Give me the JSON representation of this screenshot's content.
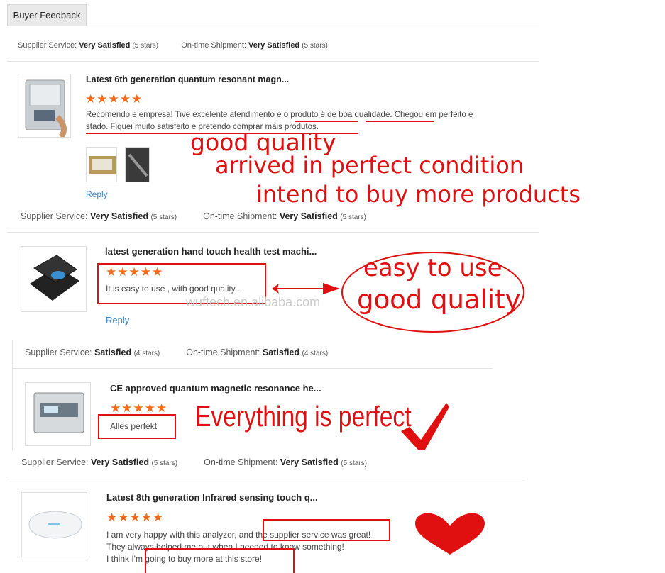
{
  "tab": {
    "label": "Buyer Feedback"
  },
  "watermark": "wuftech.en.alibaba.com",
  "reviews": [
    {
      "rating_top": {
        "supplier_label": "Supplier Service:",
        "supplier_value": "Very Satisfied",
        "supplier_count": "(5 stars)",
        "shipment_label": "On-time Shipment:",
        "shipment_value": "Very Satisfied",
        "shipment_count": "(5 stars)"
      },
      "title": "Latest 6th generation quantum resonant magn...",
      "stars": "★★★★★",
      "text_line1": "Recomendo e empresa! Tive excelente atendimento e o produto é de boa qualidade.  Chegou em perfeito e",
      "text_line2": "stado.  Fiquei muito satisfeito e pretendo comprar mais produtos.",
      "reply": "Reply",
      "annotations": [
        "good quality",
        "arrived in perfect condition",
        "intend to buy more products"
      ]
    },
    {
      "rating_top": {
        "supplier_label": "Supplier Service:",
        "supplier_value": "Very Satisfied",
        "supplier_count": "(5 stars)",
        "shipment_label": "On-time Shipment:",
        "shipment_value": "Very Satisfied",
        "shipment_count": "(5 stars)"
      },
      "title": "latest generation hand touch health test machi...",
      "stars": "★★★★★",
      "text_line1": "It is easy to use , with good quality .",
      "reply": "Reply",
      "annotations": [
        "easy to use",
        "good quality"
      ]
    },
    {
      "rating_top": {
        "supplier_label": "Supplier Service:",
        "supplier_value": "Satisfied",
        "supplier_count": "(4 stars)",
        "shipment_label": "On-time Shipment:",
        "shipment_value": "Satisfied",
        "shipment_count": "(4 stars)"
      },
      "title": "CE approved quantum magnetic resonance he...",
      "stars": "★★★★★",
      "text_line1": "Alles perfekt",
      "annotations": [
        "Everything is perfect"
      ]
    },
    {
      "rating_top": {
        "supplier_label": "Supplier Service:",
        "supplier_value": "Very Satisfied",
        "supplier_count": "(5 stars)",
        "shipment_label": "On-time Shipment:",
        "shipment_value": "Very Satisfied",
        "shipment_count": "(5 stars)"
      },
      "title": "Latest 8th generation Infrared sensing touch q...",
      "stars": "★★★★★",
      "text_line1": "I am very happy with this analyzer, and the supplier service was great!",
      "text_line2": "They always helped me out when I needed to know something!",
      "text_line3": "I think I'm going to buy more at this store!"
    }
  ],
  "colors": {
    "accent_red": "#e01010",
    "star_orange": "#f26b1d",
    "link_blue": "#3c86c6"
  }
}
